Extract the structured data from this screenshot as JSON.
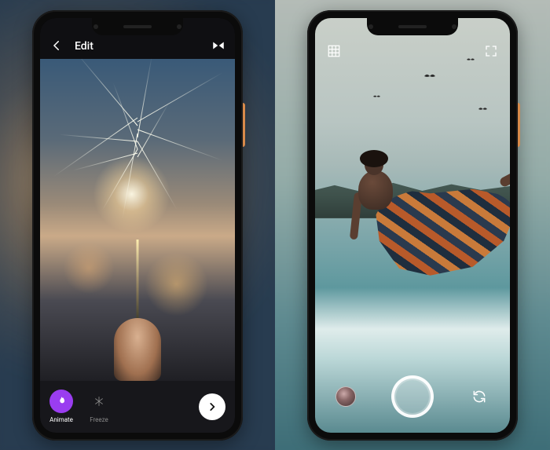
{
  "left_phone": {
    "topbar": {
      "back_icon": "arrow-left",
      "title": "Edit",
      "flip_icon": "flip-horizontal"
    },
    "toolbar": {
      "tools": [
        {
          "name": "animate",
          "label": "Animate",
          "icon": "flame",
          "active": true
        },
        {
          "name": "freeze",
          "label": "Freeze",
          "icon": "snowflake",
          "active": false
        }
      ],
      "next_icon": "chevron-right"
    },
    "accent_color": "#9a3df0"
  },
  "right_phone": {
    "top_left_icon": "grid",
    "top_right_icon": "fullscreen",
    "bottombar": {
      "gallery_icon": "gallery-thumb",
      "shutter_icon": "shutter",
      "switch_icon": "camera-switch"
    }
  }
}
